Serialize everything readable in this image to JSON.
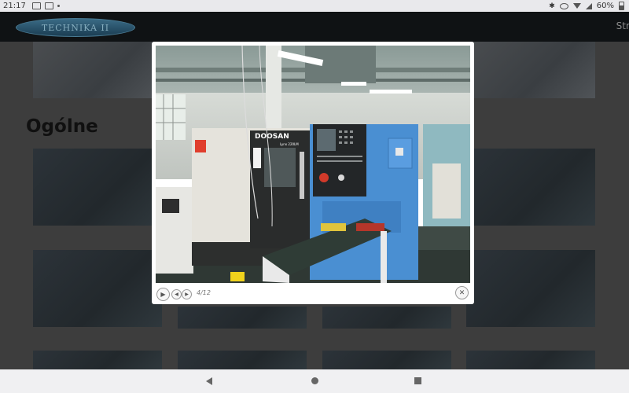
{
  "status_bar": {
    "time": "21:17",
    "battery": "60%",
    "icons": [
      "gallery-icon",
      "gallery-icon",
      "dot-icon",
      "bluetooth-icon",
      "eye-icon",
      "wifi-icon",
      "signal-icon",
      "battery-icon"
    ]
  },
  "header": {
    "logo_text": "TECHNIKA II",
    "nav_partial": "Stro"
  },
  "page": {
    "section_title": "Ogólne"
  },
  "lightbox": {
    "image_labels": {
      "machine_brand": "DOOSAN",
      "machine_model": "Lynx 220LM"
    },
    "counter": "4/12",
    "controls": {
      "play": "▶",
      "prev": "◀",
      "next": "▶",
      "close": "✕"
    }
  },
  "colors": {
    "overlay_bg": "#3d3d3d",
    "header_bg": "#0f1214",
    "machine_blue": "#4a8fd2",
    "machine_cream": "#e5e3dc"
  }
}
